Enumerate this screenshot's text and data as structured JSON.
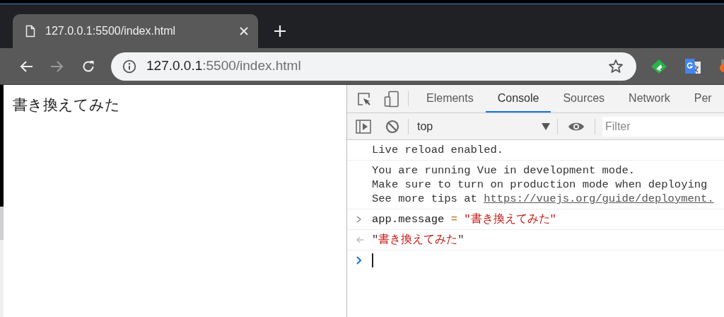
{
  "browser_tab": {
    "title": "127.0.0.1:5500/index.html"
  },
  "address_bar": {
    "host": "127.0.0.1",
    "path": ":5500/index.html"
  },
  "page": {
    "text": "書き換えてみた"
  },
  "devtools": {
    "tabs": [
      {
        "label": "Elements",
        "selected": false
      },
      {
        "label": "Console",
        "selected": true
      },
      {
        "label": "Sources",
        "selected": false
      },
      {
        "label": "Network",
        "selected": false
      },
      {
        "label": "Per",
        "selected": false
      }
    ],
    "context": "top",
    "filter": {
      "placeholder": "Filter"
    },
    "messages": [
      {
        "kind": "log",
        "lines": [
          "Live reload enabled."
        ]
      },
      {
        "kind": "log",
        "lines": [
          "You are running Vue in development mode.",
          "Make sure to turn on production mode when deploying"
        ],
        "link_prefix": "See more tips at ",
        "link": "https://vuejs.org/guide/deployment."
      },
      {
        "kind": "input",
        "expression": "app.message",
        "operator": "=",
        "value": "\"書き換えてみた\""
      },
      {
        "kind": "result",
        "parts": [
          "\"",
          "書き換えてみた",
          "\""
        ]
      },
      {
        "kind": "prompt"
      }
    ]
  }
}
